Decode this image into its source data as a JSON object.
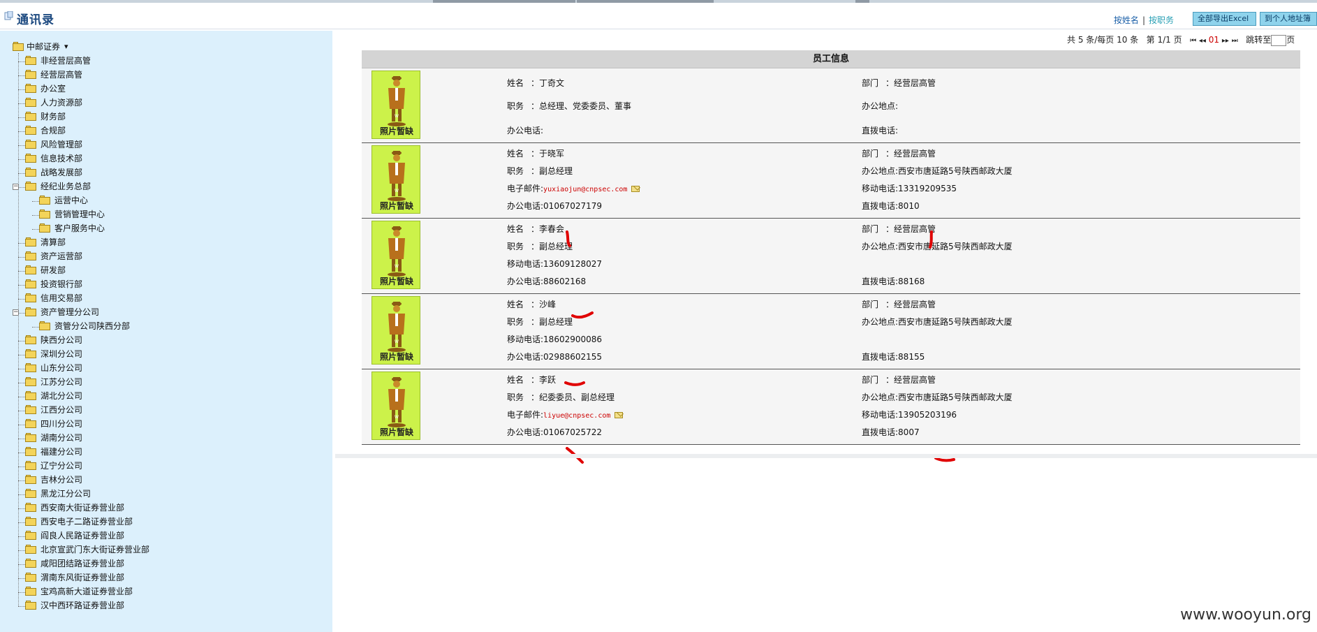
{
  "app": {
    "title": "通讯录"
  },
  "header_links": {
    "by_name": "按姓名",
    "separator": "|",
    "by_dept": "按职务"
  },
  "buttons": {
    "export": "全部导出Excel",
    "address_book": "到个人地址簿"
  },
  "pager": {
    "total": "共 5 条/每页 10 条",
    "page": "第 1/1 页",
    "current": "01",
    "jump": "跳转至",
    "page_suffix": "页"
  },
  "panel": {
    "title": "员工信息"
  },
  "labels": {
    "name": "姓名",
    "dept": "部门",
    "position": "职务",
    "office": "办公地点:",
    "office_phone": "办公电话:",
    "direct_phone": "直拨电话:",
    "email": "电子邮件:",
    "mobile": "移动电话:",
    "colon": "：",
    "photo_missing": "照片暂缺"
  },
  "tree": {
    "root": "中邮证券",
    "items": [
      {
        "label": "非经营层高管",
        "level": 1
      },
      {
        "label": "经营层高管",
        "level": 1
      },
      {
        "label": "办公室",
        "level": 1
      },
      {
        "label": "人力资源部",
        "level": 1
      },
      {
        "label": "财务部",
        "level": 1
      },
      {
        "label": "合规部",
        "level": 1
      },
      {
        "label": "风险管理部",
        "level": 1
      },
      {
        "label": "信息技术部",
        "level": 1
      },
      {
        "label": "战略发展部",
        "level": 1
      },
      {
        "label": "经纪业务总部",
        "level": 1,
        "expandable": true
      },
      {
        "label": "运营中心",
        "level": 2
      },
      {
        "label": "营销管理中心",
        "level": 2
      },
      {
        "label": "客户服务中心",
        "level": 2
      },
      {
        "label": "清算部",
        "level": 1
      },
      {
        "label": "资产运营部",
        "level": 1
      },
      {
        "label": "研发部",
        "level": 1
      },
      {
        "label": "投资银行部",
        "level": 1
      },
      {
        "label": "信用交易部",
        "level": 1
      },
      {
        "label": "资产管理分公司",
        "level": 1,
        "expandable": true
      },
      {
        "label": "资管分公司陕西分部",
        "level": 2
      },
      {
        "label": "陕西分公司",
        "level": 1
      },
      {
        "label": "深圳分公司",
        "level": 1
      },
      {
        "label": "山东分公司",
        "level": 1
      },
      {
        "label": "江苏分公司",
        "level": 1
      },
      {
        "label": "湖北分公司",
        "level": 1
      },
      {
        "label": "江西分公司",
        "level": 1
      },
      {
        "label": "四川分公司",
        "level": 1
      },
      {
        "label": "湖南分公司",
        "level": 1
      },
      {
        "label": "福建分公司",
        "level": 1
      },
      {
        "label": "辽宁分公司",
        "level": 1
      },
      {
        "label": "吉林分公司",
        "level": 1
      },
      {
        "label": "黑龙江分公司",
        "level": 1
      },
      {
        "label": "西安南大街证券营业部",
        "level": 1
      },
      {
        "label": "西安电子二路证券营业部",
        "level": 1
      },
      {
        "label": "阎良人民路证券营业部",
        "level": 1
      },
      {
        "label": "北京宣武门东大街证券营业部",
        "level": 1
      },
      {
        "label": "咸阳团结路证券营业部",
        "level": 1
      },
      {
        "label": "渭南东风街证券营业部",
        "level": 1
      },
      {
        "label": "宝鸡高新大道证券营业部",
        "level": 1
      },
      {
        "label": "汉中西环路证券营业部",
        "level": 1
      }
    ]
  },
  "employees": [
    {
      "name": "丁奇文",
      "dept": "经营层高管",
      "position": "总经理、党委委员、董事",
      "office": "",
      "office_phone": "",
      "direct_phone": ""
    },
    {
      "name": "于晓军",
      "dept": "经营层高管",
      "position": "副总经理",
      "office": "西安市唐延路5号陕西邮政大厦",
      "email": "yuxiaojun@cnpsec.com",
      "mobile": "13319209535",
      "office_phone": "01067027179",
      "direct_phone": "8010"
    },
    {
      "name": "李春会",
      "dept": "经营层高管",
      "position": "副总经理",
      "office": "西安市唐延路5号陕西邮政大厦",
      "mobile": "13609128027",
      "office_phone": "88602168",
      "direct_phone": "88168"
    },
    {
      "name": "沙峰",
      "dept": "经营层高管",
      "position": "副总经理",
      "office": "西安市唐延路5号陕西邮政大厦",
      "mobile": "18602900086",
      "office_phone": "02988602155",
      "direct_phone": "88155"
    },
    {
      "name": "李跃",
      "dept": "经营层高管",
      "position": "纪委委员、副总经理",
      "office": "西安市唐延路5号陕西邮政大厦",
      "email": "liyue@cnpsec.com",
      "mobile": "13905203196",
      "office_phone": "01067025722",
      "direct_phone": "8007"
    }
  ],
  "watermark": "www.wooyun.org"
}
